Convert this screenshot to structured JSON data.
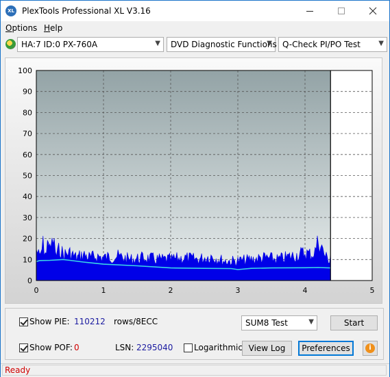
{
  "window": {
    "title": "PlexTools Professional XL V3.16",
    "app_icon_text": "XL",
    "minimize_icon": "minimize-icon",
    "maximize_icon": "maximize-icon",
    "close_icon": "close-icon"
  },
  "menu": [
    {
      "label": "Options",
      "mnemonic": "O"
    },
    {
      "label": "Help",
      "mnemonic": "H"
    }
  ],
  "toolbar": {
    "drive": "HA:7 ID:0  PX-760A",
    "function": "DVD Diagnostic Functions",
    "test": "Q-Check PI/PO Test"
  },
  "chart_data": {
    "type": "area",
    "x_ticks": [
      "0",
      "1",
      "2",
      "3",
      "4",
      "5"
    ],
    "y_ticks": [
      "100",
      "90",
      "80",
      "70",
      "60",
      "50",
      "40",
      "30",
      "20",
      "10",
      "0"
    ],
    "xlim": [
      0,
      5
    ],
    "ylim": [
      0,
      100
    ],
    "data_end_x": 4.38,
    "grid": true,
    "colors": {
      "pie_fill": "#0000e8",
      "avg_line": "#3ad6e6",
      "plot_bg_top": "#93a3a6",
      "plot_bg_bottom": "#e9eeee",
      "unused_bg": "#ffffff"
    },
    "series": [
      {
        "values": "PIE fill (per-position upper envelope)",
        "x": [
          0,
          0.05,
          0.1,
          0.15,
          0.18,
          0.2,
          0.25,
          0.3,
          0.35,
          0.4,
          0.5,
          0.6,
          0.7,
          0.8,
          0.9,
          1.0,
          1.2,
          1.4,
          1.6,
          1.8,
          2.0,
          2.2,
          2.4,
          2.6,
          2.8,
          3.0,
          3.2,
          3.4,
          3.6,
          3.8,
          4.0,
          4.1,
          4.15,
          4.2,
          4.25,
          4.3,
          4.38
        ],
        "y": [
          19,
          14,
          22,
          16,
          28,
          18,
          25,
          15,
          20,
          16,
          17,
          14,
          16,
          14,
          15,
          14,
          15,
          13,
          14,
          13,
          13,
          14,
          13,
          15,
          12,
          12,
          13,
          14,
          13,
          15,
          17,
          16,
          18,
          25,
          20,
          15,
          12
        ]
      },
      {
        "values": "Average line",
        "x": [
          0,
          0.05,
          0.2,
          0.4,
          0.5,
          0.7,
          1.0,
          1.5,
          2.0,
          2.5,
          2.9,
          3.0,
          3.2,
          3.5,
          4.0,
          4.2,
          4.38
        ],
        "y": [
          9,
          9.5,
          9.6,
          10,
          9.6,
          8.8,
          7.8,
          7,
          6,
          5.8,
          5.7,
          5.2,
          5.8,
          6.0,
          6.1,
          6.2,
          6.0
        ]
      }
    ]
  },
  "bottom": {
    "show_pie_label": "Show PIE:",
    "pie_value": "110212",
    "pie_unit": "rows/8ECC",
    "show_pof_label": "Show POF:",
    "pof_value": "0",
    "lsn_label": "LSN:",
    "lsn_value": "2295040",
    "log_label": "Logarithmic",
    "test_select": "SUM8 Test",
    "start_button": "Start",
    "view_log_button": "View Log",
    "preferences_button": "Preferences",
    "info_icon": "info-icon"
  },
  "status": {
    "text": "Ready"
  }
}
